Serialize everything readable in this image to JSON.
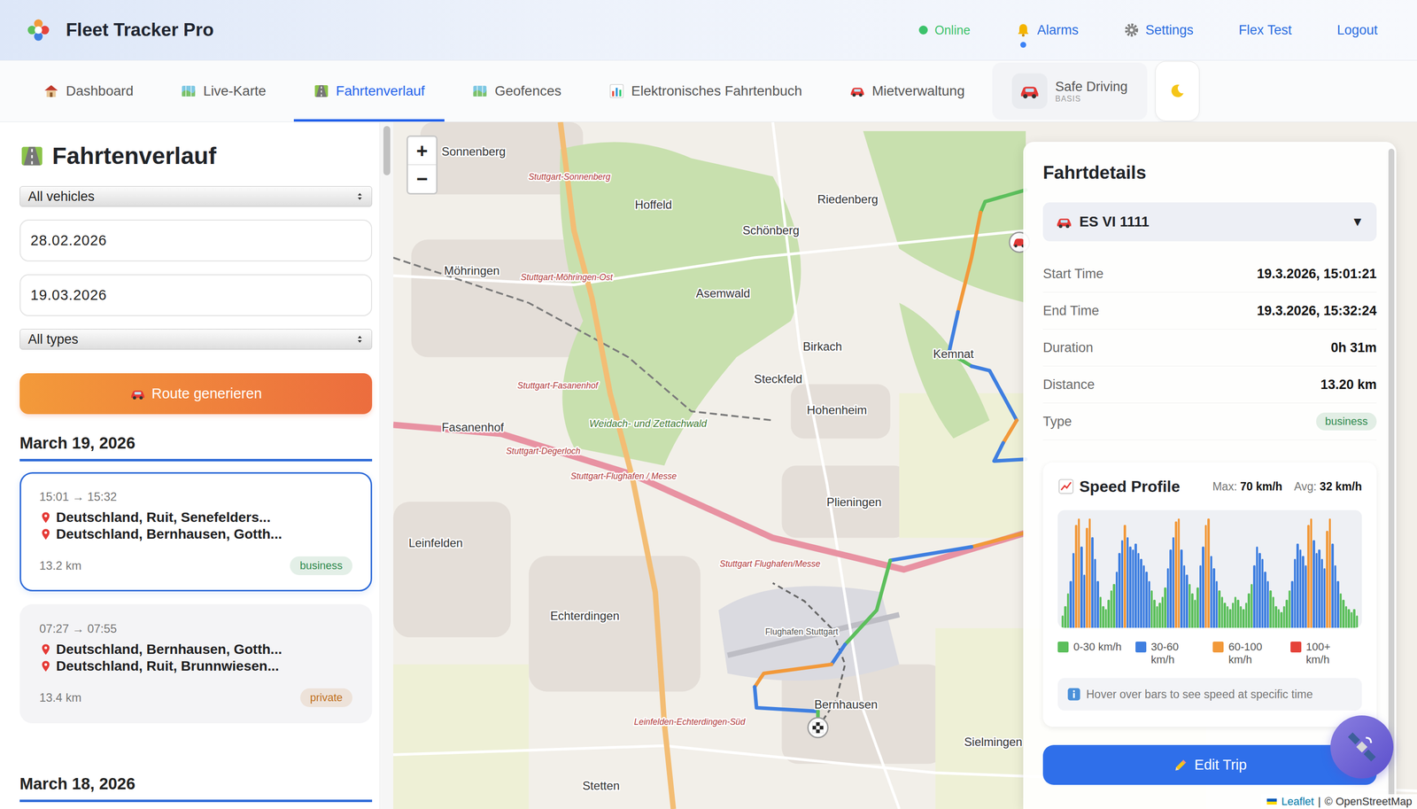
{
  "app": {
    "title": "Fleet Tracker Pro"
  },
  "header": {
    "status": {
      "label": "Online",
      "online": true
    },
    "links": [
      {
        "label": "Alarms",
        "indicator": true
      },
      {
        "label": "Settings",
        "indicator": false
      },
      {
        "label": "Flex Test",
        "indicator": false
      },
      {
        "label": "Logout",
        "indicator": false
      }
    ]
  },
  "tabs": [
    {
      "label": "Dashboard",
      "selected": false
    },
    {
      "label": "Live-Karte",
      "selected": false
    },
    {
      "label": "Fahrtenverlauf",
      "selected": true
    },
    {
      "label": "Geofences",
      "selected": false
    },
    {
      "label": "Elektronisches Fahrtenbuch",
      "selected": false
    },
    {
      "label": "Mietverwaltung",
      "selected": false
    }
  ],
  "plan": {
    "label": "Safe Driving",
    "tier": "BASIS"
  },
  "sidebar": {
    "title": "Fahrtenverlauf",
    "vehicle_filter": "All vehicles",
    "date_from": "28.02.2026",
    "date_to": "19.03.2026",
    "type_filter": "All types",
    "generate_button": "Route generieren",
    "days": [
      {
        "date": "March 19, 2026",
        "trips": [
          {
            "time": "15:01 → 15:32",
            "from": "Deutschland, Ruit, Senefelders...",
            "to": "Deutschland, Bernhausen, Gotth...",
            "distance": "13.2 km",
            "type": "business",
            "color": "#2f8a4e",
            "selected": true
          },
          {
            "time": "07:27 → 07:55",
            "from": "Deutschland, Bernhausen, Gotth...",
            "to": "Deutschland, Ruit, Brunnwiesen...",
            "distance": "13.4 km",
            "type": "private",
            "color": "#c0701c",
            "selected": false
          }
        ]
      },
      {
        "date": "March 18, 2026",
        "trips": []
      }
    ]
  },
  "map": {
    "zoom_in": "+",
    "zoom_out": "−",
    "attribution": {
      "link": "Leaflet",
      "separator": "|",
      "text": "© OpenStreetMap"
    },
    "places": [
      {
        "name": "Sonnenberg",
        "kind": "town"
      },
      {
        "name": "Hoffeld",
        "kind": "town"
      },
      {
        "name": "Riedenberg",
        "kind": "town"
      },
      {
        "name": "Schönberg",
        "kind": "town"
      },
      {
        "name": "Möhringen",
        "kind": "town"
      },
      {
        "name": "Asemwald",
        "kind": "town"
      },
      {
        "name": "Birkach",
        "kind": "town"
      },
      {
        "name": "Kemnat",
        "kind": "town"
      },
      {
        "name": "Steckfeld",
        "kind": "town"
      },
      {
        "name": "Hohenheim",
        "kind": "town"
      },
      {
        "name": "Fasanenhof",
        "kind": "town"
      },
      {
        "name": "Plieningen",
        "kind": "town"
      },
      {
        "name": "Leinfelden",
        "kind": "town"
      },
      {
        "name": "Echterdingen",
        "kind": "town"
      },
      {
        "name": "Bernhausen",
        "kind": "town"
      },
      {
        "name": "Sielmingen",
        "kind": "town"
      },
      {
        "name": "Stetten",
        "kind": "town"
      },
      {
        "name": "Stuttgart-Sonnenberg",
        "kind": "station"
      },
      {
        "name": "Stuttgart-Möhringen-Ost",
        "kind": "station"
      },
      {
        "name": "Stuttgart-Fasanenhof",
        "kind": "station"
      },
      {
        "name": "Stuttgart-Degerloch",
        "kind": "station"
      },
      {
        "name": "Stuttgart-Flughafen / Messe",
        "kind": "station"
      },
      {
        "name": "Stuttgart Flughafen/Messe",
        "kind": "station"
      },
      {
        "name": "Leinfelden-Echterdingen-Süd",
        "kind": "station"
      },
      {
        "name": "Weidach- und Zettachwald",
        "kind": "area"
      },
      {
        "name": "Flughafen Stuttgart",
        "kind": "landmark"
      }
    ]
  },
  "details": {
    "title": "Fahrtdetails",
    "vehicle": "ES VI 1111",
    "dropdown": "▼",
    "fields": [
      {
        "label": "Start Time",
        "value": "19.3.2026, 15:01:21",
        "kind": "text"
      },
      {
        "label": "End Time",
        "value": "19.3.2026, 15:32:24",
        "kind": "text"
      },
      {
        "label": "Duration",
        "value": "0h 31m",
        "kind": "text"
      },
      {
        "label": "Distance",
        "value": "13.20 km",
        "kind": "text"
      },
      {
        "label": "Type",
        "value": "business",
        "kind": "badge",
        "color": "#2f8a4e"
      }
    ],
    "speed_profile": {
      "title": "Speed Profile",
      "max_label": "Max:",
      "max": "70 km/h",
      "avg_label": "Avg:",
      "avg": "32 km/h",
      "legend": [
        {
          "label": "0-30 km/h",
          "color": "#5cbf5c"
        },
        {
          "label": "30-60 km/h",
          "color": "#3f7fe0"
        },
        {
          "label": "60-100 km/h",
          "color": "#f2993a"
        },
        {
          "label": "100+ km/h",
          "color": "#e5433a"
        }
      ],
      "values": [
        8,
        14,
        22,
        30,
        48,
        66,
        70,
        52,
        34,
        64,
        70,
        58,
        44,
        30,
        20,
        14,
        12,
        18,
        24,
        28,
        36,
        48,
        56,
        66,
        58,
        52,
        50,
        54,
        48,
        44,
        40,
        36,
        30,
        24,
        18,
        14,
        16,
        20,
        26,
        38,
        50,
        58,
        68,
        70,
        50,
        40,
        34,
        28,
        22,
        18,
        26,
        40,
        52,
        66,
        70,
        46,
        38,
        30,
        24,
        20,
        16,
        14,
        12,
        16,
        20,
        18,
        14,
        12,
        16,
        22,
        28,
        40,
        52,
        48,
        44,
        36,
        30,
        24,
        20,
        14,
        12,
        10,
        14,
        18,
        24,
        30,
        44,
        54,
        50,
        46,
        40,
        66,
        70,
        56,
        48,
        50,
        44,
        38,
        62,
        70,
        54,
        40,
        30,
        22,
        18,
        14,
        12,
        10,
        12,
        8
      ],
      "hint": "Hover over bars to see speed at specific time"
    },
    "edit_button": "Edit Trip"
  }
}
